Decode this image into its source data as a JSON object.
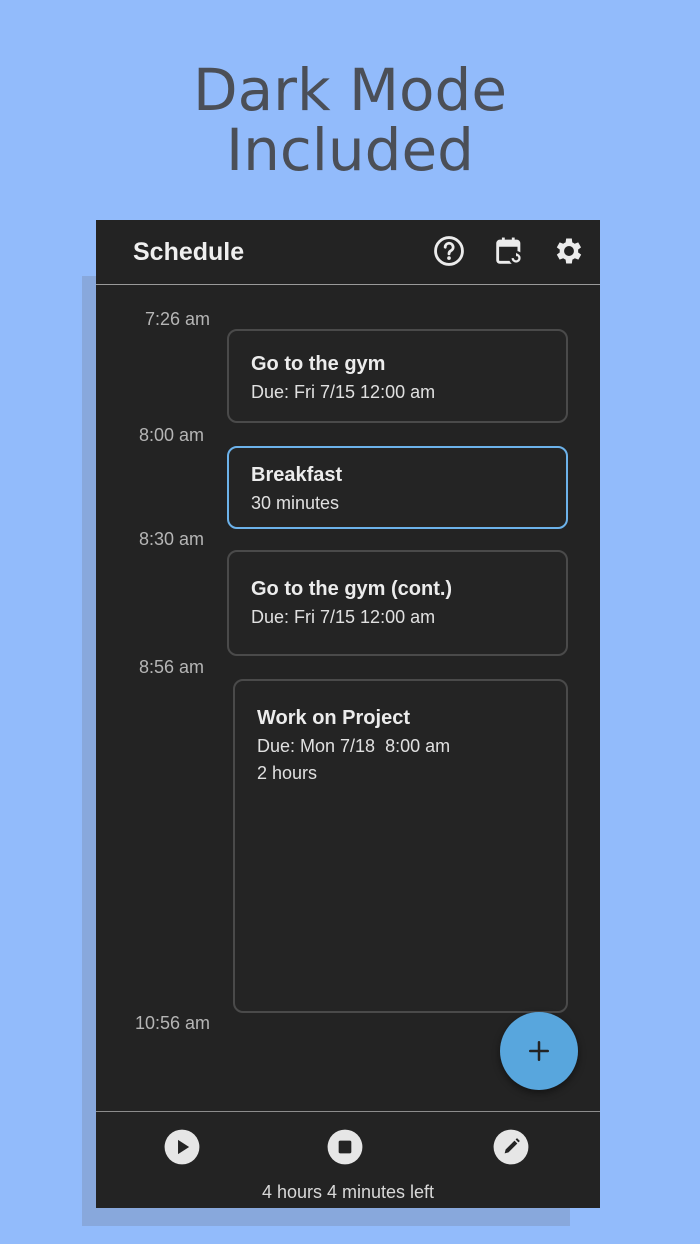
{
  "promo": {
    "line1": "Dark Mode",
    "line2": "Included"
  },
  "appbar": {
    "title": "Schedule",
    "icons": [
      "help-icon",
      "calendar-sync-icon",
      "gear-icon"
    ]
  },
  "timeline": {
    "times": [
      "7:26 am",
      "8:00 am",
      "8:30 am",
      "8:56 am",
      "10:56 am"
    ],
    "events": [
      {
        "title": "Go to the gym",
        "lines": [
          "Due: Fri 7/15 12:00 am"
        ]
      },
      {
        "title": "Breakfast",
        "lines": [
          "30 minutes"
        ]
      },
      {
        "title": "Go to the gym (cont.)",
        "lines": [
          "Due: Fri 7/15 12:00 am"
        ]
      },
      {
        "title": "Work on Project",
        "lines": [
          "Due: Mon 7/18  8:00 am",
          "2 hours"
        ]
      }
    ],
    "selected_event_index": 1
  },
  "fab": {
    "icon": "plus-icon"
  },
  "bottombar": {
    "icons": [
      "play-icon",
      "stop-icon",
      "edit-icon"
    ],
    "time_left": "4 hours 4 minutes left"
  },
  "colors": {
    "background": "#92bbfb",
    "surface": "#232323",
    "accent": "#58a6dd",
    "selected_border": "#6cb2ea"
  }
}
